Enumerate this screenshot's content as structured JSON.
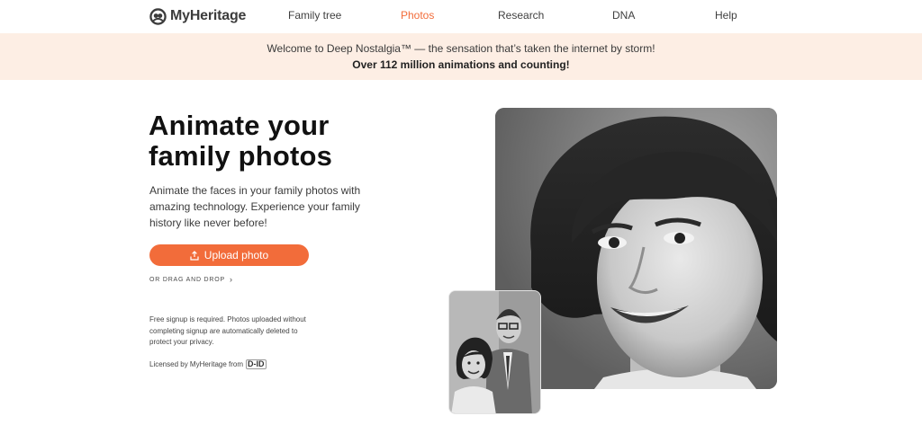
{
  "header": {
    "logo_text": "MyHeritage",
    "nav": [
      {
        "label": "Family tree"
      },
      {
        "label": "Photos",
        "active": true
      },
      {
        "label": "Research"
      },
      {
        "label": "DNA"
      },
      {
        "label": "Help"
      }
    ]
  },
  "banner": {
    "line1": "Welcome to Deep Nostalgia™ — the sensation that’s taken the internet by storm!",
    "line2": "Over 112 million animations and counting!"
  },
  "hero": {
    "title": "Animate your family photos",
    "description": "Animate the faces in your family photos with amazing technology. Experience your family history like never before!",
    "upload_button": "Upload photo",
    "drag_drop": "OR DRAG AND DROP",
    "notice": "Free signup is required. Photos uploaded without completing signup are automatically deleted to protect your privacy.",
    "licensed": "Licensed by MyHeritage from",
    "licensed_logo": "D-ID"
  },
  "colors": {
    "accent": "#f26c3a",
    "banner_bg": "#fdeee4"
  },
  "icons": {
    "logo": "myheritage-logo-icon",
    "upload": "upload-icon",
    "chevron": "chevron-right-icon"
  }
}
